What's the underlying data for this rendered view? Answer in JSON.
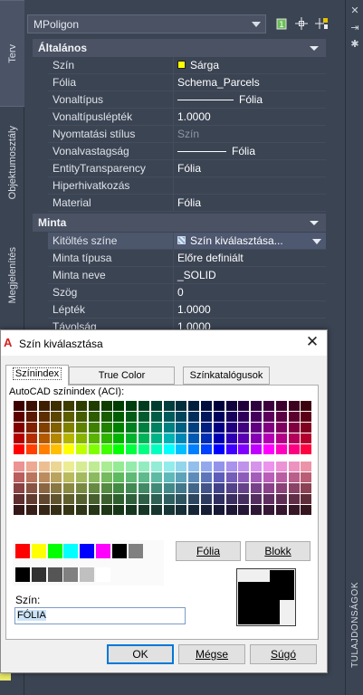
{
  "palette": {
    "object_type": "MPoligon",
    "side_title": "TULAJDONSÁGOK",
    "vtabs": [
      "Terv",
      "Objektumosztály",
      "Megjelenítés"
    ],
    "sections": [
      {
        "title": "Általános",
        "rows": [
          {
            "name": "Szín",
            "value": "Sárga",
            "kind": "color"
          },
          {
            "name": "Fólia",
            "value": "Schema_Parcels"
          },
          {
            "name": "Vonaltípus",
            "value": "Fólia",
            "kind": "linetype"
          },
          {
            "name": "Vonaltípuslépték",
            "value": "1.0000"
          },
          {
            "name": "Nyomtatási stílus",
            "value": "Szín",
            "kind": "dim"
          },
          {
            "name": "Vonalvastagság",
            "value": "Fólia",
            "kind": "lineweight"
          },
          {
            "name": "EntityTransparency",
            "value": "Fólia"
          },
          {
            "name": "Hiperhivatkozás",
            "value": ""
          },
          {
            "name": "Material",
            "value": "Fólia"
          }
        ]
      },
      {
        "title": "Minta",
        "rows": [
          {
            "name": "Kitöltés színe",
            "value": "Szín kiválasztása...",
            "kind": "dropdown"
          },
          {
            "name": "Minta típusa",
            "value": "Előre definiált"
          },
          {
            "name": "Minta neve",
            "value": "_SOLID"
          },
          {
            "name": "Szög",
            "value": "0"
          },
          {
            "name": "Lépték",
            "value": "1.0000"
          },
          {
            "name": "Távolság",
            "value": "1.0000"
          }
        ]
      }
    ]
  },
  "dialog": {
    "title": "Szín kiválasztása",
    "tabs": [
      "Színindex",
      "True Color",
      "Színkatalógusok"
    ],
    "aci_label": "AutoCAD színindex (ACI):",
    "fólia_button": "Fólia",
    "blokk_button": "Blokk",
    "szin_label": "Szín:",
    "szin_value": "FÓLIA",
    "ok_button": "OK",
    "cancel_button": "Mégse",
    "help_button": "Súgó"
  }
}
